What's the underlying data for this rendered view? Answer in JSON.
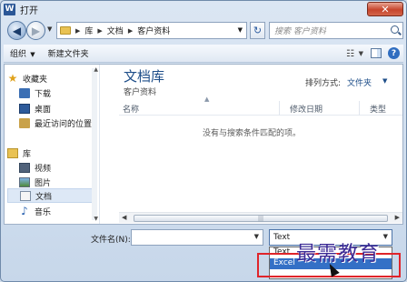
{
  "window": {
    "title": "打开",
    "app_icon": "W",
    "close": "✕"
  },
  "nav": {
    "back": "◀",
    "forward": "▶",
    "breadcrumb": [
      "库",
      "文档",
      "客户资料"
    ],
    "search_placeholder": "搜索 客户资料"
  },
  "toolbar": {
    "organize": "组织",
    "new_folder": "新建文件夹"
  },
  "sidebar": {
    "favorites_title": "收藏夹",
    "favorites": [
      "下载",
      "桌面",
      "最近访问的位置"
    ],
    "libraries_title": "库",
    "libraries": [
      "视频",
      "图片",
      "文档",
      "音乐"
    ]
  },
  "main": {
    "library_title": "文档库",
    "library_sub": "客户资料",
    "arrange_label": "排列方式:",
    "arrange_value": "文件夹",
    "columns": [
      "名称",
      "修改日期",
      "类型"
    ],
    "empty_message": "没有与搜索条件匹配的项。"
  },
  "bottom": {
    "filename_label": "文件名(N):",
    "filename_value": "",
    "filetype_value": "Text",
    "filetype_options": [
      "Text",
      "Excel"
    ]
  },
  "watermark": "最需教育",
  "colors": {
    "accent": "#1e4e89",
    "highlight": "#e0242a",
    "selected_option": "#3470c6"
  }
}
